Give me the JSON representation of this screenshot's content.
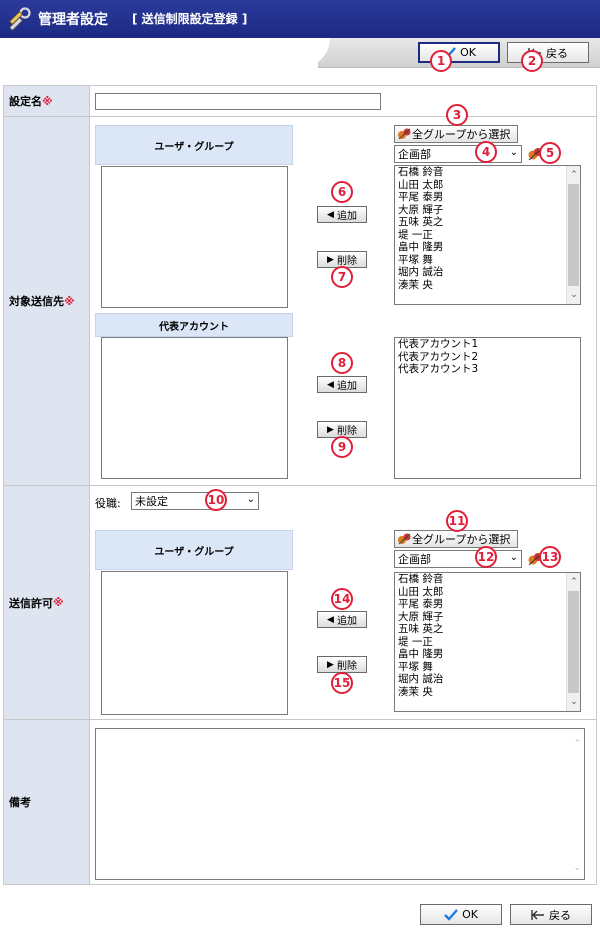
{
  "header": {
    "title": "管理者設定",
    "subtitle": "[ 送信制限設定登録 ]"
  },
  "toolbar": {
    "ok_label": "OK",
    "back_label": "戻る"
  },
  "form": {
    "setting_name": {
      "label": "設定名",
      "required_mark": "※",
      "value": ""
    },
    "target": {
      "label": "対象送信先",
      "required_mark": "※",
      "user_group_header": "ユーザ・グループ",
      "rep_account_header": "代表アカウント",
      "add_label": "追加",
      "delete_label": "削除",
      "all_group_label": "全グループから選択",
      "department": "企画部",
      "users": [
        "石橋 鈴音",
        "山田 太郎",
        "平尾 泰男",
        "大原 輝子",
        "五味 英之",
        "堤 一正",
        "畠中 隆男",
        "平塚 舞",
        "堀内 誠治",
        "湊茉 央"
      ],
      "rep_accounts": [
        "代表アカウント1",
        "代表アカウント2",
        "代表アカウント3"
      ]
    },
    "permission": {
      "label": "送信許可",
      "required_mark": "※",
      "role_label": "役職:",
      "role_value": "未設定",
      "user_group_header": "ユーザ・グループ",
      "add_label": "追加",
      "delete_label": "削除",
      "all_group_label": "全グループから選択",
      "department": "企画部",
      "users": [
        "石橋 鈴音",
        "山田 太郎",
        "平尾 泰男",
        "大原 輝子",
        "五味 英之",
        "堤 一正",
        "畠中 隆男",
        "平塚 舞",
        "堀内 誠治",
        "湊茉 央"
      ]
    },
    "notes": {
      "label": "備考",
      "value": ""
    }
  },
  "footer": {
    "ok_label": "OK",
    "back_label": "戻る"
  },
  "callouts": [
    "1",
    "2",
    "3",
    "4",
    "5",
    "6",
    "7",
    "8",
    "9",
    "10",
    "11",
    "12",
    "13",
    "14",
    "15"
  ],
  "colors": {
    "header_bg": "#1c2a84",
    "label_bg": "#dfe4f1",
    "panel_head_bg": "#dbe6f7",
    "required": "#e0203a",
    "callout": "#e0203a"
  }
}
